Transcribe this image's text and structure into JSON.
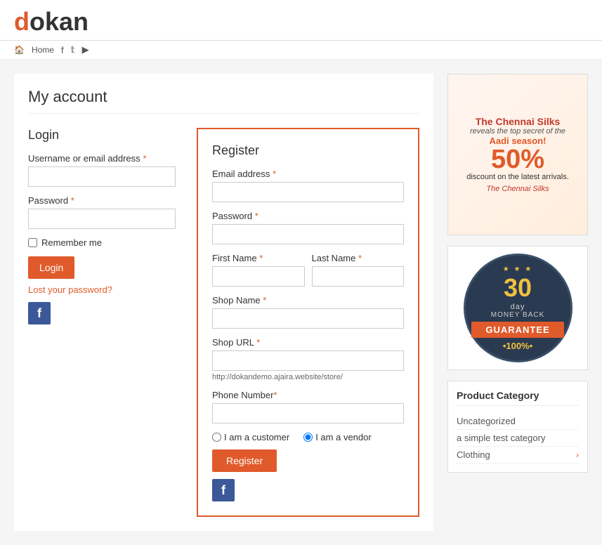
{
  "brand": {
    "logo_d": "d",
    "logo_rest": "okan"
  },
  "nav": {
    "home": "Home",
    "icons": [
      "facebook",
      "twitter",
      "youtube"
    ]
  },
  "page": {
    "title": "My account"
  },
  "login": {
    "section_title": "Login",
    "username_label": "Username or email address",
    "password_label": "Password",
    "remember_label": "Remember me",
    "login_button": "Login",
    "lost_password": "Lost your password?"
  },
  "register": {
    "section_title": "Register",
    "email_label": "Email address",
    "password_label": "Password",
    "first_name_label": "First Name",
    "last_name_label": "Last Name",
    "shop_name_label": "Shop Name",
    "shop_url_label": "Shop URL",
    "shop_url_hint": "http://dokandemo.ajaira.website/store/",
    "phone_label": "Phone Number",
    "radio_customer": "I am a customer",
    "radio_vendor": "I am a vendor",
    "register_button": "Register"
  },
  "ad": {
    "line1": "The Chennai Silks",
    "line2": "reveals the top secret of the",
    "line3": "Aadi season!",
    "discount": "50%",
    "sub_text": "discount on the latest arrivals.",
    "brand_name": "The Chennai Silks"
  },
  "guarantee": {
    "days": "30",
    "day_label": "day",
    "money_back": "MONEY BACK",
    "guarantee_text": "GUARANTEE",
    "pct": "•100%•"
  },
  "product_category": {
    "title": "Product Category",
    "items": [
      {
        "name": "Uncategorized",
        "has_arrow": false
      },
      {
        "name": "a simple test category",
        "has_arrow": false
      },
      {
        "name": "Clothing",
        "has_arrow": true
      }
    ]
  }
}
